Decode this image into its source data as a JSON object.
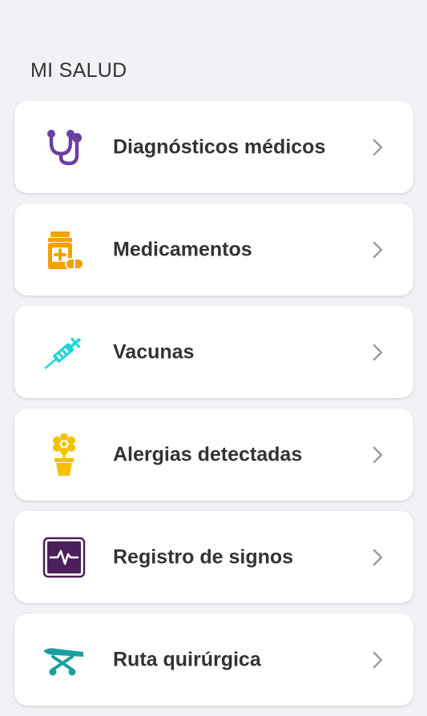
{
  "section_title": "MI SALUD",
  "items": [
    {
      "label": "Diagnósticos médicos",
      "icon": "stethoscope-icon",
      "color": "#6b3fa0"
    },
    {
      "label": "Medicamentos",
      "icon": "medicine-bottle-icon",
      "color": "#f5a000"
    },
    {
      "label": "Vacunas",
      "icon": "syringe-icon",
      "color": "#22d4d4"
    },
    {
      "label": "Alergias detectadas",
      "icon": "flower-pot-icon",
      "color": "#f5c000"
    },
    {
      "label": "Registro de signos",
      "icon": "vital-signs-monitor-icon",
      "color": "#4a1f5c"
    },
    {
      "label": "Ruta quirúrgica",
      "icon": "stretcher-icon",
      "color": "#1a9e9e"
    }
  ],
  "colors": {
    "background": "#f1f1f6",
    "card": "#ffffff",
    "text": "#333333",
    "chevron": "#9a9a9a"
  }
}
